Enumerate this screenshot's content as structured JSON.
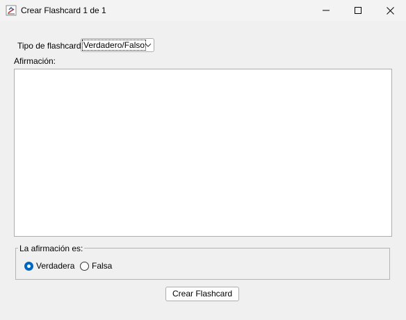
{
  "window": {
    "title": "Crear Flashcard 1 de 1",
    "icon": "java-app-icon",
    "controls": [
      "minimize-icon",
      "maximize-icon",
      "close-icon"
    ]
  },
  "form": {
    "type_label": "Tipo de flashcard:",
    "type_selected": "Verdadero/Falso",
    "statement_label": "Afirmación:",
    "statement_value": "",
    "answer_group_title": "La afirmación es:",
    "options": [
      {
        "label": "Verdadera",
        "checked": true
      },
      {
        "label": "Falsa",
        "checked": false
      }
    ],
    "submit_label": "Crear Flashcard"
  },
  "colors": {
    "accent": "#0067c0",
    "window_bg": "#f0f0f0",
    "titlebar_bg": "#f3f3f3"
  }
}
